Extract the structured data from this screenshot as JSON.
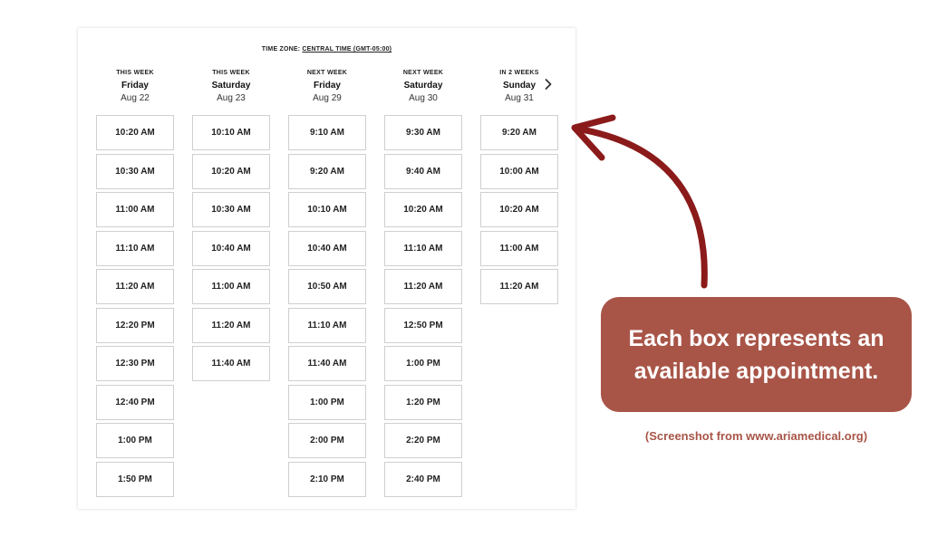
{
  "timezone": {
    "label": "TIME ZONE:",
    "value": "CENTRAL TIME (GMT-05:00)"
  },
  "days": [
    {
      "week": "THIS WEEK",
      "day": "Friday",
      "date": "Aug 22",
      "slots": [
        "10:20 AM",
        "10:30 AM",
        "11:00 AM",
        "11:10 AM",
        "11:20 AM",
        "12:20 PM",
        "12:30 PM",
        "12:40 PM",
        "1:00 PM",
        "1:50 PM"
      ]
    },
    {
      "week": "THIS WEEK",
      "day": "Saturday",
      "date": "Aug 23",
      "slots": [
        "10:10 AM",
        "10:20 AM",
        "10:30 AM",
        "10:40 AM",
        "11:00 AM",
        "11:20 AM",
        "11:40 AM"
      ]
    },
    {
      "week": "NEXT WEEK",
      "day": "Friday",
      "date": "Aug 29",
      "slots": [
        "9:10 AM",
        "9:20 AM",
        "10:10 AM",
        "10:40 AM",
        "10:50 AM",
        "11:10 AM",
        "11:40 AM",
        "1:00 PM",
        "2:00 PM",
        "2:10 PM"
      ]
    },
    {
      "week": "NEXT WEEK",
      "day": "Saturday",
      "date": "Aug 30",
      "slots": [
        "9:30 AM",
        "9:40 AM",
        "10:20 AM",
        "11:10 AM",
        "11:20 AM",
        "12:50 PM",
        "1:00 PM",
        "1:20 PM",
        "2:20 PM",
        "2:40 PM"
      ]
    },
    {
      "week": "IN 2 WEEKS",
      "day": "Sunday",
      "date": "Aug 31",
      "slots": [
        "9:20 AM",
        "10:00 AM",
        "10:20 AM",
        "11:00 AM",
        "11:20 AM"
      ]
    }
  ],
  "next_icon": "chevron-right-icon",
  "callout": {
    "text": "Each box represents an\navailable appointment."
  },
  "credit": "(Screenshot from www.ariamedical.org)",
  "colors": {
    "accent": "#a85548",
    "arrow": "#8b1a1a",
    "slot_border": "#cfcfcf"
  }
}
